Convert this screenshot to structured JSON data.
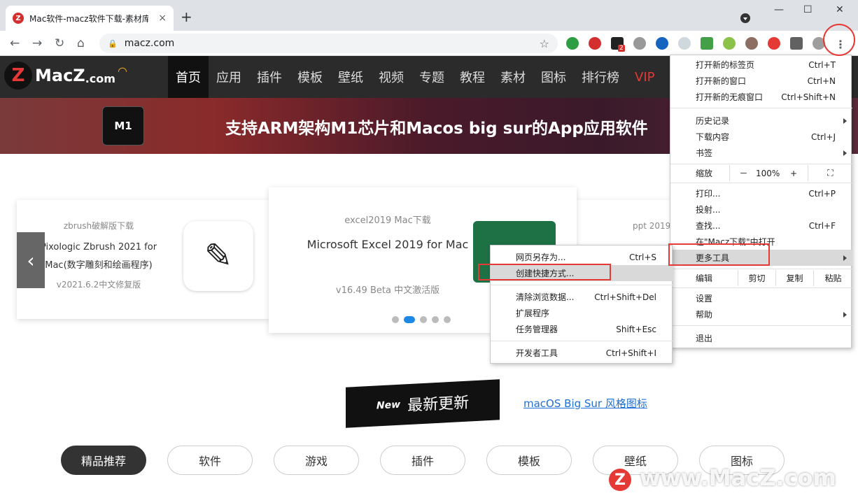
{
  "tab": {
    "title": "Mac软件-macz软件下载-素材库",
    "close": "×",
    "favicon": "Z"
  },
  "newtab": "+",
  "window": {
    "minimize": "—",
    "maximize": "☐",
    "close": "✕"
  },
  "nav": {
    "back": "←",
    "forward": "→",
    "reload": "↻",
    "home": "⌂"
  },
  "omnibox": {
    "url": "macz.com",
    "lock": "🔒",
    "star": "☆"
  },
  "site": {
    "logo_z": "Z",
    "logo_text": "MacZ",
    "logo_com": ".com",
    "menu": [
      "首页",
      "应用",
      "插件",
      "模板",
      "壁纸",
      "视频",
      "专题",
      "教程",
      "素材",
      "图标",
      "排行榜",
      "VIP"
    ],
    "banner_badge": "M1",
    "banner_text": "支持ARM架构M1芯片和Macos big sur的App应用软件",
    "cards": [
      {
        "tag": "zbrush破解版下载",
        "title1": "Pixologic Zbrush 2021 for",
        "title2": "Mac(数字雕刻和绘画程序)",
        "ver": "v2021.6.2中文修复版"
      },
      {
        "tag": "excel2019 Mac下载",
        "title": "Microsoft Excel 2019 for Mac",
        "ver": "v16.49 Beta 中文激活版"
      },
      {
        "tag": "ppt 2019"
      }
    ],
    "prev": "‹",
    "section_new": "New",
    "section_title": "最新更新",
    "section_link": "macOS Big Sur 风格图标",
    "pills": [
      "精品推荐",
      "软件",
      "游戏",
      "插件",
      "模板",
      "壁纸",
      "图标"
    ],
    "watermark": "www.MacZ.com"
  },
  "chrome_menu": {
    "items1": [
      {
        "label": "打开新的标签页",
        "shortcut": "Ctrl+T"
      },
      {
        "label": "打开新的窗口",
        "shortcut": "Ctrl+N"
      },
      {
        "label": "打开新的无痕窗口",
        "shortcut": "Ctrl+Shift+N"
      }
    ],
    "items2": [
      {
        "label": "历史记录",
        "shortcut": ""
      },
      {
        "label": "下载内容",
        "shortcut": "Ctrl+J"
      },
      {
        "label": "书签",
        "shortcut": ""
      }
    ],
    "zoom": {
      "label": "缩放",
      "minus": "－",
      "value": "100%",
      "plus": "+",
      "full": "⛶"
    },
    "items3": [
      {
        "label": "打印...",
        "shortcut": "Ctrl+P"
      },
      {
        "label": "投射...",
        "shortcut": ""
      },
      {
        "label": "查找...",
        "shortcut": "Ctrl+F"
      },
      {
        "label": "在\"Macz下载\"中打开",
        "shortcut": ""
      },
      {
        "label": "更多工具",
        "shortcut": ""
      }
    ],
    "edit": {
      "label": "编辑",
      "cut": "剪切",
      "copy": "复制",
      "paste": "粘贴"
    },
    "items4": [
      {
        "label": "设置",
        "shortcut": ""
      },
      {
        "label": "帮助",
        "shortcut": ""
      }
    ],
    "exit": "退出"
  },
  "sub_menu": {
    "items1": [
      {
        "label": "网页另存为...",
        "shortcut": "Ctrl+S"
      },
      {
        "label": "创建快捷方式...",
        "shortcut": ""
      }
    ],
    "items2": [
      {
        "label": "清除浏览数据...",
        "shortcut": "Ctrl+Shift+Del"
      },
      {
        "label": "扩展程序",
        "shortcut": ""
      },
      {
        "label": "任务管理器",
        "shortcut": "Shift+Esc"
      }
    ],
    "items3": [
      {
        "label": "开发者工具",
        "shortcut": "Ctrl+Shift+I"
      }
    ]
  },
  "ext_badge": "2"
}
